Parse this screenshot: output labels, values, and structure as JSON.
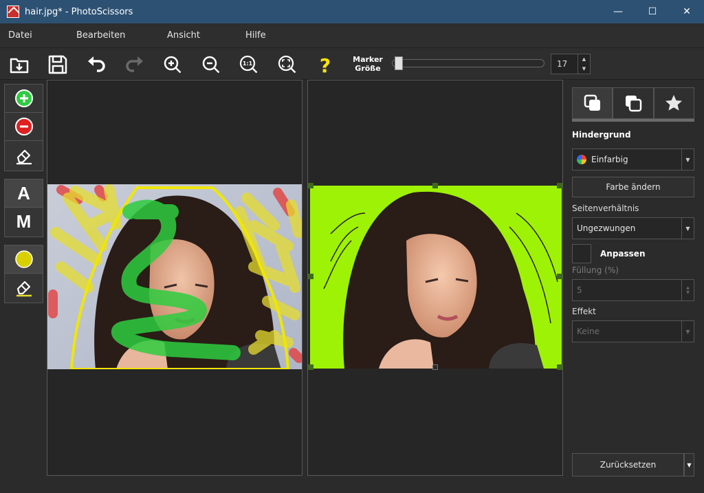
{
  "window": {
    "title": "hair.jpg* - PhotoScissors",
    "minimize": "—",
    "maximize": "☐",
    "close": "✕"
  },
  "menu": [
    "Datei",
    "Bearbeiten",
    "Ansicht",
    "Hilfe"
  ],
  "toolbar": {
    "marker_label_line1": "Marker",
    "marker_label_line2": "Größe",
    "marker_size": "17",
    "marker_fraction": 0.02,
    "icons": [
      "open-icon",
      "save-icon",
      "undo-icon",
      "redo-icon",
      "zoom-in-icon",
      "zoom-out-icon",
      "zoom-actual-icon",
      "zoom-fit-icon",
      "help-icon"
    ]
  },
  "tools": {
    "keep": "plus-icon",
    "remove": "minus-icon",
    "eraser": "eraser-icon",
    "mode_auto": "A",
    "mode_manual": "M",
    "hair": "yellow-circle-icon",
    "hair_eraser": "eraser-icon"
  },
  "side": {
    "tabs": [
      "background-tab-icon",
      "foreground-tab-icon",
      "effects-tab-icon"
    ],
    "background_heading": "Hindergrund",
    "background_type": "Einfarbig",
    "change_color": "Farbe ändern",
    "aspect_label": "Seitenverhältnis",
    "aspect_value": "Ungezwungen",
    "fit_label": "Anpassen",
    "fill_label": "Füllung (%)",
    "fill_value": "5",
    "effect_label": "Effekt",
    "effect_value": "Keine",
    "reset": "Zurücksetzen"
  },
  "colors": {
    "accent_green": "#9ef206",
    "keep_marker": "#2ecc40",
    "hair_marker": "#e6dc2e",
    "remove_marker": "#e04848"
  }
}
